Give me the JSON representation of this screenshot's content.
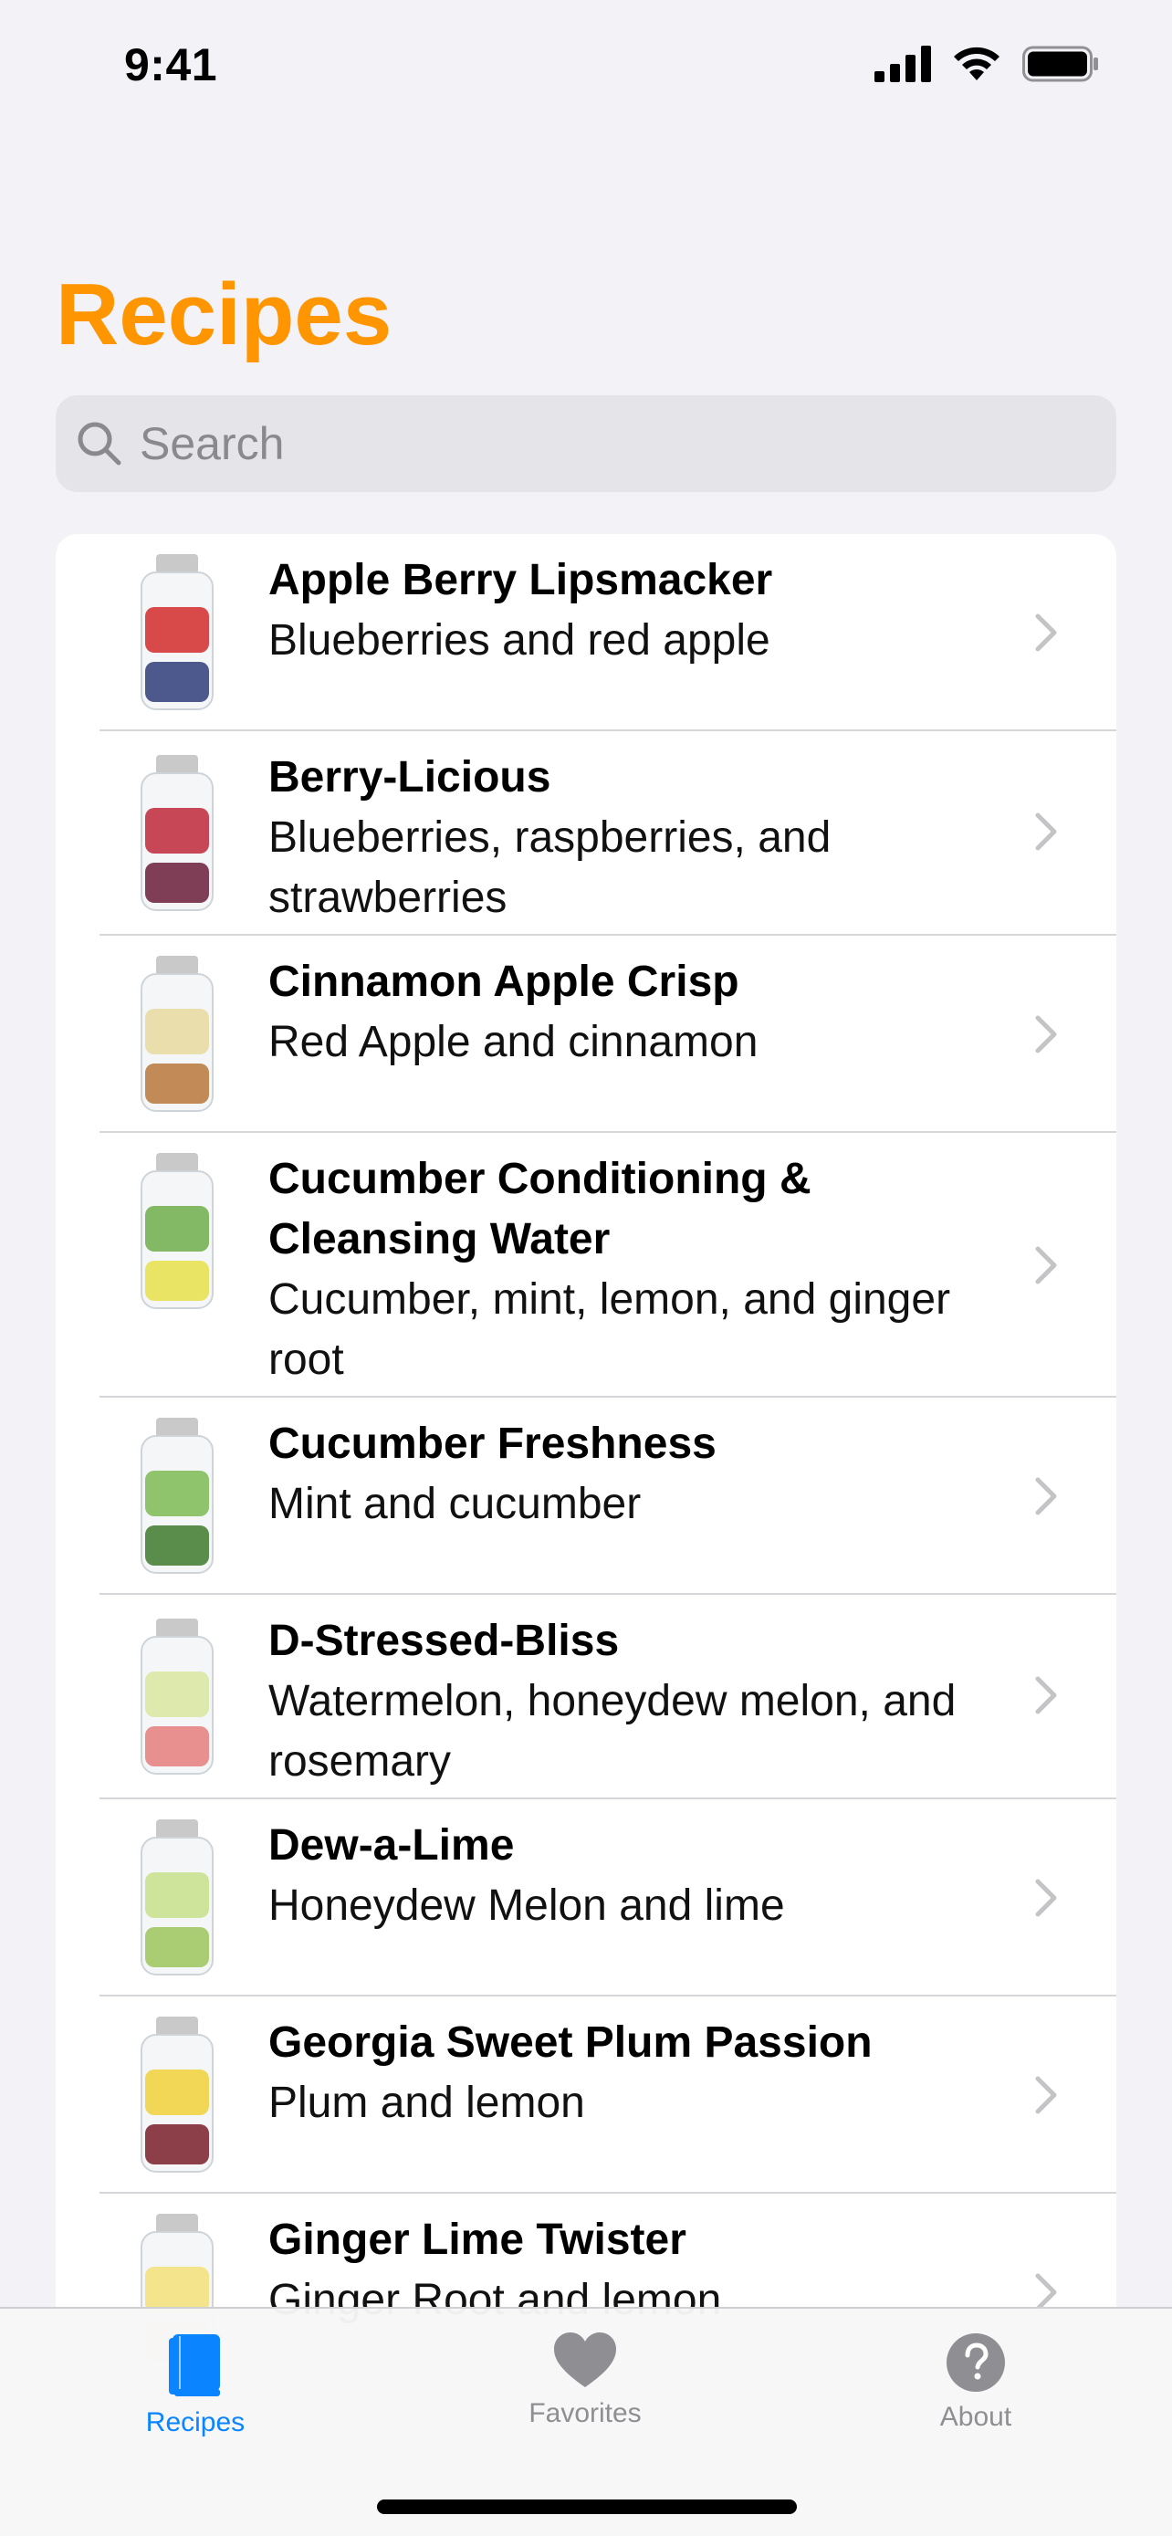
{
  "status": {
    "time": "9:41"
  },
  "page": {
    "title": "Recipes"
  },
  "search": {
    "placeholder": "Search"
  },
  "recipes": [
    {
      "title": "Apple Berry Lipsmacker",
      "subtitle": "Blueberries and red apple",
      "colors": [
        "#d22b2b",
        "#2f3c7a"
      ]
    },
    {
      "title": "Berry-Licious",
      "subtitle": "Blueberries, raspberries, and strawberries",
      "colors": [
        "#c0283a",
        "#6a1c3a"
      ]
    },
    {
      "title": "Cinnamon Apple Crisp",
      "subtitle": "Red Apple and cinnamon",
      "colors": [
        "#e8d9a0",
        "#b7773a"
      ]
    },
    {
      "title": "Cucumber Conditioning & Cleansing Water",
      "subtitle": "Cucumber, mint, lemon, and ginger root",
      "colors": [
        "#6fae4a",
        "#e8e04a"
      ]
    },
    {
      "title": "Cucumber Freshness",
      "subtitle": "Mint and cucumber",
      "colors": [
        "#7dbb55",
        "#3e7a2e"
      ]
    },
    {
      "title": "D-Stressed-Bliss",
      "subtitle": "Watermelon, honeydew melon, and rosemary",
      "colors": [
        "#d9e6a0",
        "#e57d7d"
      ]
    },
    {
      "title": "Dew-a-Lime",
      "subtitle": "Honeydew Melon and lime",
      "colors": [
        "#c7e08a",
        "#9cc65c"
      ]
    },
    {
      "title": "Georgia Sweet Plum Passion",
      "subtitle": "Plum and lemon",
      "colors": [
        "#f1d13a",
        "#7a1f2a"
      ]
    },
    {
      "title": "Ginger Lime Twister",
      "subtitle": "Ginger Root and lemon",
      "colors": [
        "#f3e27a",
        "#e2d9a0"
      ]
    }
  ],
  "tabs": [
    {
      "label": "Recipes",
      "icon": "book-icon",
      "active": true
    },
    {
      "label": "Favorites",
      "icon": "heart-icon",
      "active": false
    },
    {
      "label": "About",
      "icon": "question-icon",
      "active": false
    }
  ],
  "colors": {
    "accent": "#ff9500",
    "tab_active": "#0a84ff",
    "tab_inactive": "#8e8e93"
  }
}
